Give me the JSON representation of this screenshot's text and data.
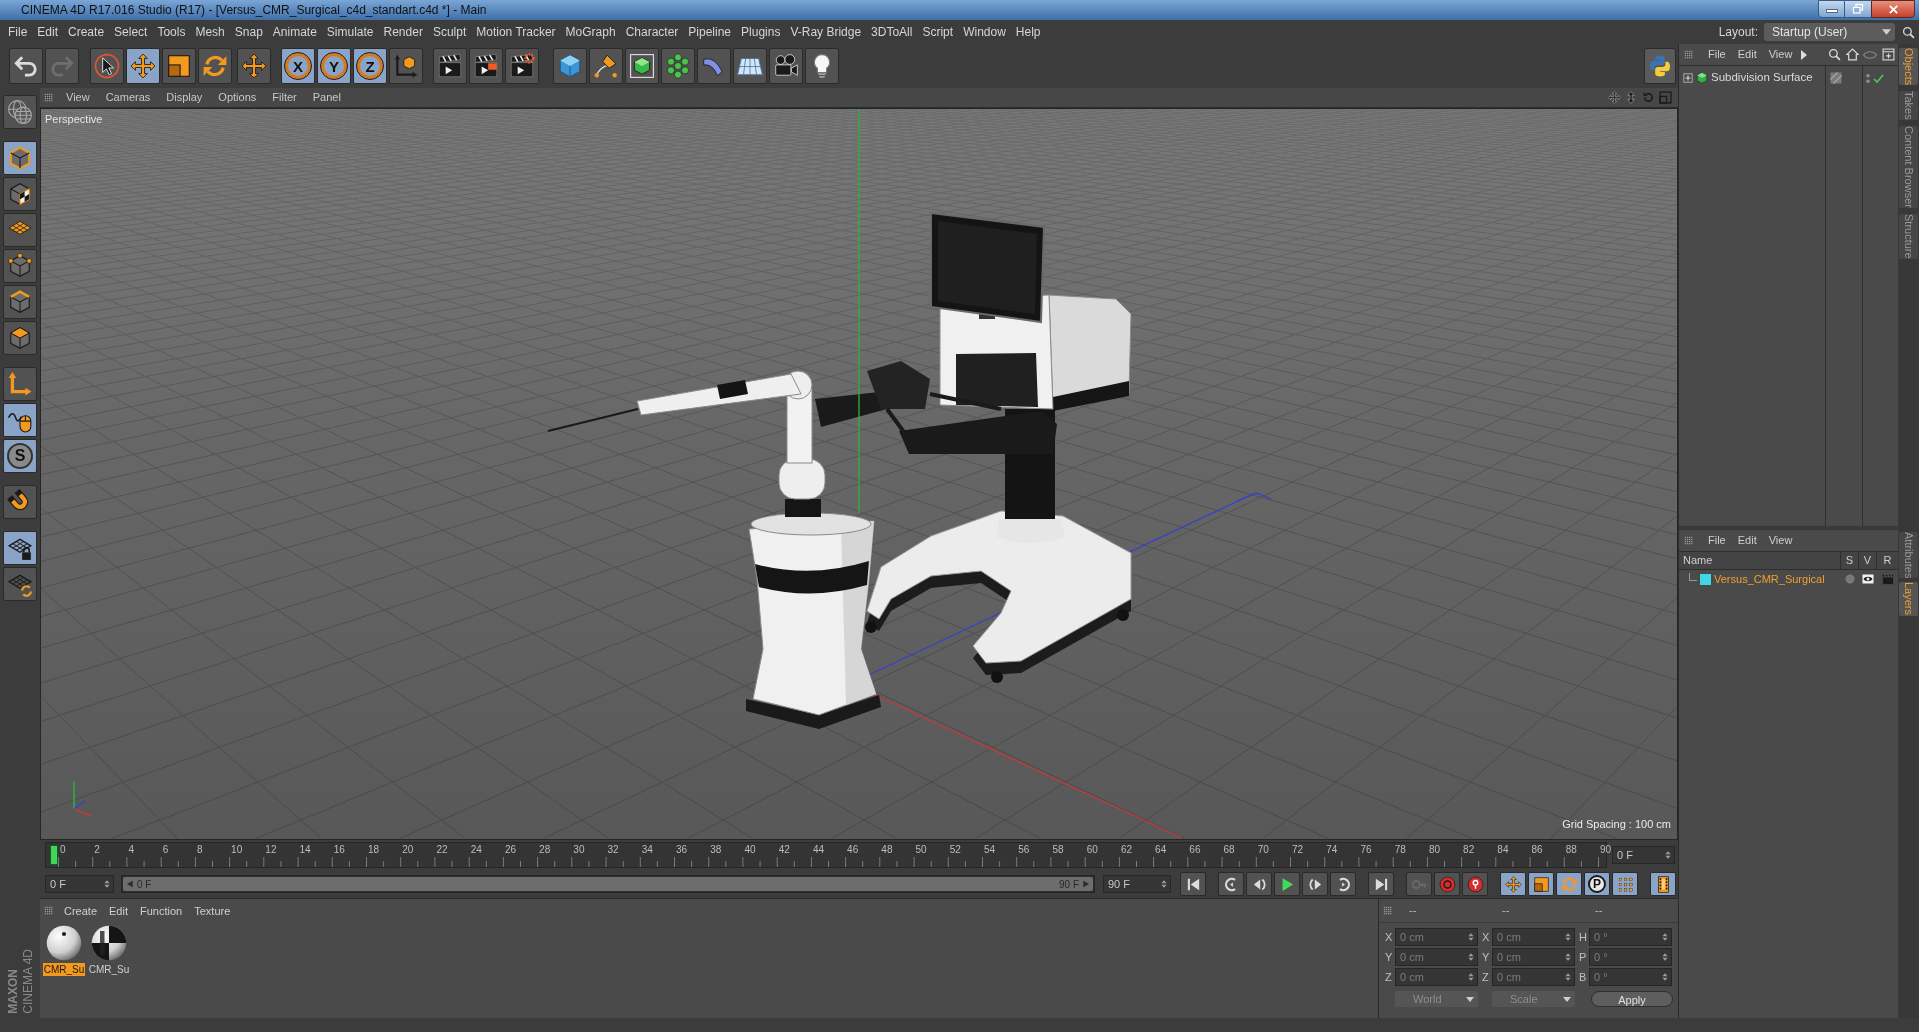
{
  "window": {
    "title": "CINEMA 4D R17.016 Studio (R17) - [Versus_CMR_Surgical_c4d_standart.c4d *] - Main"
  },
  "menu_bar": {
    "items": [
      "File",
      "Edit",
      "Create",
      "Select",
      "Tools",
      "Mesh",
      "Snap",
      "Animate",
      "Simulate",
      "Render",
      "Sculpt",
      "Motion Tracker",
      "MoGraph",
      "Character",
      "Pipeline",
      "Plugins",
      "V-Ray Bridge",
      "3DToAll",
      "Script",
      "Window",
      "Help"
    ],
    "layout_label": "Layout:",
    "layout_value": "Startup (User)"
  },
  "toolbar": {
    "groups": [
      [
        {
          "kind": "icon",
          "selected": false,
          "disabled": false
        },
        {
          "kind": "icon",
          "selected": false,
          "disabled": true
        }
      ],
      [
        {
          "kind": "icon",
          "selected": false,
          "disabled": false
        },
        {
          "kind": "icon",
          "selected": true,
          "disabled": false
        },
        {
          "kind": "icon",
          "selected": false,
          "disabled": false
        },
        {
          "kind": "icon",
          "selected": false,
          "disabled": false
        }
      ],
      [
        {
          "kind": "icon",
          "selected": false,
          "disabled": false
        }
      ],
      [
        {
          "kind": "letter",
          "label": "X",
          "selected": true,
          "disabled": false
        },
        {
          "kind": "letter",
          "label": "Y",
          "selected": true,
          "disabled": false
        },
        {
          "kind": "letter",
          "label": "Z",
          "selected": true,
          "disabled": false
        },
        {
          "kind": "icon",
          "selected": false,
          "disabled": false
        }
      ],
      [
        {
          "kind": "icon",
          "selected": false,
          "disabled": false
        },
        {
          "kind": "icon",
          "selected": false,
          "disabled": false
        },
        {
          "kind": "icon",
          "selected": false,
          "disabled": false
        }
      ],
      [
        {
          "kind": "icon",
          "selected": false,
          "disabled": false
        },
        {
          "kind": "icon",
          "selected": false,
          "disabled": false
        },
        {
          "kind": "icon",
          "selected": false,
          "disabled": false
        },
        {
          "kind": "icon",
          "selected": false,
          "disabled": false
        },
        {
          "kind": "icon",
          "selected": false,
          "disabled": false
        },
        {
          "kind": "icon",
          "selected": false,
          "disabled": false
        },
        {
          "kind": "icon",
          "selected": false,
          "disabled": false
        },
        {
          "kind": "icon",
          "selected": false,
          "disabled": false
        }
      ]
    ]
  },
  "mode_toolbar": {
    "groups": [
      [
        {
          "kind": "icon",
          "selected": false
        }
      ],
      [
        {
          "kind": "icon",
          "selected": true
        },
        {
          "kind": "icon",
          "selected": false
        },
        {
          "kind": "icon",
          "selected": false
        }
      ],
      [
        {
          "kind": "icon",
          "selected": false
        },
        {
          "kind": "icon",
          "selected": false
        },
        {
          "kind": "icon",
          "selected": false
        }
      ],
      [
        {
          "kind": "icon",
          "selected": false
        },
        {
          "kind": "icon",
          "selected": true
        },
        {
          "kind": "letter",
          "label": "S",
          "selected": true
        }
      ],
      [
        {
          "kind": "icon",
          "selected": false
        }
      ],
      [
        {
          "kind": "icon",
          "selected": true
        },
        {
          "kind": "icon",
          "selected": false
        }
      ]
    ]
  },
  "viewport": {
    "menu": [
      "View",
      "Cameras",
      "Display",
      "Options",
      "Filter",
      "Panel"
    ],
    "camera": "Perspective",
    "grid_spacing": "Grid Spacing : 100 cm"
  },
  "timeline": {
    "frames": [
      "0",
      "2",
      "4",
      "6",
      "8",
      "10",
      "12",
      "14",
      "16",
      "18",
      "20",
      "22",
      "24",
      "26",
      "28",
      "30",
      "32",
      "34",
      "36",
      "38",
      "40",
      "42",
      "44",
      "46",
      "48",
      "50",
      "52",
      "54",
      "56",
      "58",
      "60",
      "62",
      "64",
      "66",
      "68",
      "70",
      "72",
      "74",
      "76",
      "78",
      "80",
      "82",
      "84",
      "86",
      "88",
      "90"
    ],
    "level": 0,
    "current_frame": "0 F"
  },
  "transport": {
    "start_field": "0 F",
    "range_start": "0 F",
    "range_end": "90 F",
    "end_field": "90 F",
    "groups": [
      [
        {
          "kind": "icon",
          "selected": false,
          "disabled": false
        }
      ],
      [
        {
          "kind": "icon",
          "selected": false,
          "disabled": false
        },
        {
          "kind": "icon",
          "selected": false,
          "disabled": false
        },
        {
          "kind": "icon",
          "selected": false,
          "disabled": false
        },
        {
          "kind": "icon",
          "selected": false,
          "disabled": false
        },
        {
          "kind": "icon",
          "selected": false,
          "disabled": false
        }
      ],
      [
        {
          "kind": "icon",
          "selected": false,
          "disabled": false
        }
      ],
      [
        {
          "kind": "icon",
          "selected": false,
          "disabled": true
        },
        {
          "kind": "icon",
          "selected": false,
          "disabled": false
        },
        {
          "kind": "icon",
          "selected": false,
          "disabled": false
        }
      ],
      [
        {
          "kind": "icon",
          "selected": true,
          "disabled": false
        },
        {
          "kind": "icon",
          "selected": true,
          "disabled": false
        },
        {
          "kind": "icon",
          "selected": true,
          "disabled": false
        },
        {
          "kind": "letter",
          "label": "P",
          "selected": true,
          "disabled": false
        },
        {
          "kind": "icon",
          "selected": true,
          "disabled": false
        }
      ],
      [
        {
          "kind": "icon",
          "selected": true,
          "disabled": false
        }
      ]
    ]
  },
  "material_manager": {
    "menu": [
      "Create",
      "Edit",
      "Function",
      "Texture"
    ],
    "materials": [
      {
        "name": "CMR_Su",
        "selected": true
      },
      {
        "name": "CMR_Su",
        "selected": false
      }
    ]
  },
  "coordinates": {
    "headers": [
      "--",
      "--",
      "--"
    ],
    "rows": [
      {
        "cells": [
          {
            "axis": "X",
            "value": "0 cm"
          },
          {
            "axis": "X",
            "value": "0 cm"
          },
          {
            "axis": "H",
            "value": "0 °"
          }
        ]
      },
      {
        "cells": [
          {
            "axis": "Y",
            "value": "0 cm"
          },
          {
            "axis": "Y",
            "value": "0 cm"
          },
          {
            "axis": "P",
            "value": "0 °"
          }
        ]
      },
      {
        "cells": [
          {
            "axis": "Z",
            "value": "0 cm"
          },
          {
            "axis": "Z",
            "value": "0 cm"
          },
          {
            "axis": "B",
            "value": "0 °"
          }
        ]
      }
    ],
    "dropdowns": [
      "World",
      "Scale"
    ],
    "apply": "Apply"
  },
  "object_manager": {
    "menu": [
      "File",
      "Edit",
      "View"
    ],
    "objects": [
      {
        "name": "Subdivision Surface",
        "expanded": false,
        "enabled": true
      }
    ]
  },
  "layer_manager": {
    "menu": [
      "File",
      "Edit",
      "View"
    ],
    "columns": [
      "Name",
      "S",
      "V",
      "R"
    ],
    "layers": [
      {
        "name": "Versus_CMR_Surgical",
        "color": "#3fd8e2",
        "solo": false,
        "visible": true,
        "render": true
      }
    ]
  },
  "side_tabs_top": [
    {
      "label": "Objects",
      "selected": true
    },
    {
      "label": "Takes",
      "selected": false
    },
    {
      "label": "Content Browser",
      "selected": false
    },
    {
      "label": "Structure",
      "selected": false
    }
  ],
  "side_tabs_bottom": [
    {
      "label": "Attributes",
      "selected": false
    },
    {
      "label": "Layers",
      "selected": true
    }
  ],
  "logo": {
    "line_1": "MAXON",
    "line_2": "CINEMA 4D"
  }
}
